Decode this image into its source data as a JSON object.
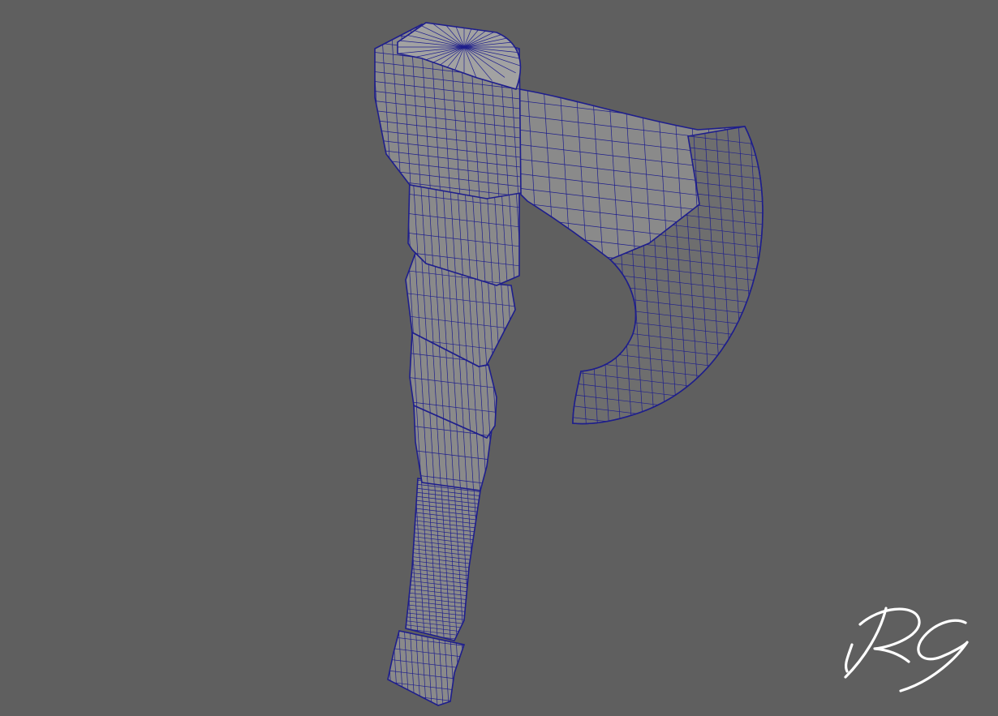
{
  "viewport": {
    "background_color": "#5f5f5f"
  },
  "model": {
    "subject": "axe",
    "fill_color": "#8a8a8a",
    "wire_color": "#1e1e8c",
    "shadow_color": "#6e6e6e",
    "highlight_color": "#a2a2a2"
  },
  "signature": {
    "text": "RG",
    "color": "#ffffff"
  }
}
